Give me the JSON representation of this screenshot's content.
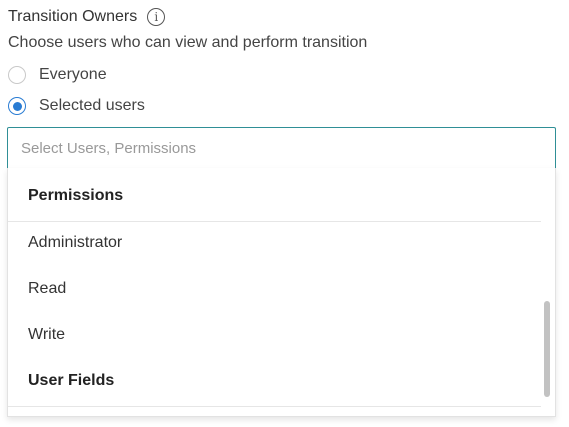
{
  "section": {
    "title": "Transition Owners",
    "subtitle": "Choose users who can view and perform transition",
    "info_icon": "info-icon"
  },
  "radios": [
    {
      "label": "Everyone",
      "checked": false
    },
    {
      "label": "Selected users",
      "checked": true
    }
  ],
  "select": {
    "placeholder": "Select Users, Permissions"
  },
  "dropdown": {
    "groups": [
      {
        "header": "Permissions",
        "options": [
          "Administrator",
          "Read",
          "Write"
        ]
      },
      {
        "header": "User Fields",
        "options": []
      }
    ]
  },
  "colors": {
    "accent": "#2a7cd3",
    "focus_border": "#2f8f96"
  }
}
